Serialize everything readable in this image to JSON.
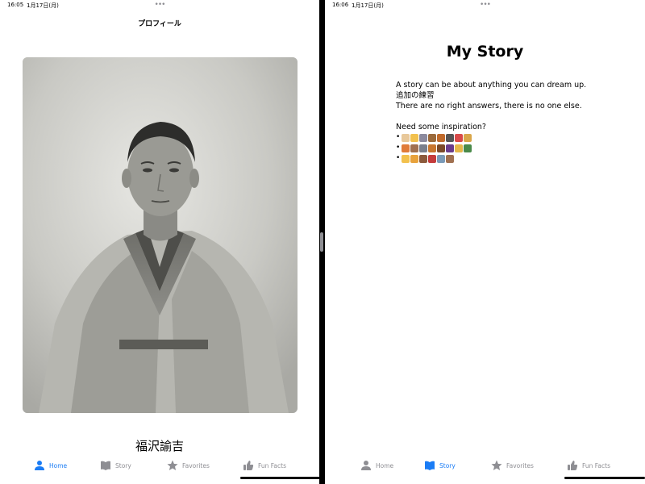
{
  "left": {
    "status": {
      "time": "16:05",
      "date": "1月17日(月)"
    },
    "nav_title": "プロフィール",
    "person_name": "福沢諭吉",
    "tabs": [
      {
        "label": "Home",
        "icon": "person-icon",
        "active": true
      },
      {
        "label": "Story",
        "icon": "book-icon",
        "active": false
      },
      {
        "label": "Favorites",
        "icon": "star-icon",
        "active": false
      },
      {
        "label": "Fun Facts",
        "icon": "thumbs-up-icon",
        "active": false
      }
    ]
  },
  "right": {
    "status": {
      "time": "16:06",
      "date": "1月17日(月)"
    },
    "title": "My Story",
    "lines": [
      "A story can be about anything you can dream up.",
      "追加の練習",
      "There are no right answers, there is no one else."
    ],
    "inspiration_heading": "Need some inspiration?",
    "emoji_rows": [
      [
        "dog",
        "cat",
        "hippo",
        "horse",
        "guitar",
        "microphone",
        "balloon",
        "paint"
      ],
      [
        "skier",
        "mountain",
        "spaceship",
        "volcano",
        "boot",
        "dancer",
        "pizza",
        "books"
      ],
      [
        "pencil",
        "ruler",
        "coffee",
        "soccer",
        "bike",
        "tools"
      ]
    ],
    "tabs": [
      {
        "label": "Home",
        "icon": "person-icon",
        "active": false
      },
      {
        "label": "Story",
        "icon": "book-icon",
        "active": true
      },
      {
        "label": "Favorites",
        "icon": "star-icon",
        "active": false
      },
      {
        "label": "Fun Facts",
        "icon": "thumbs-up-icon",
        "active": false
      }
    ]
  },
  "colors": {
    "accent": "#1a7cf5",
    "inactive": "#8e8e93"
  }
}
